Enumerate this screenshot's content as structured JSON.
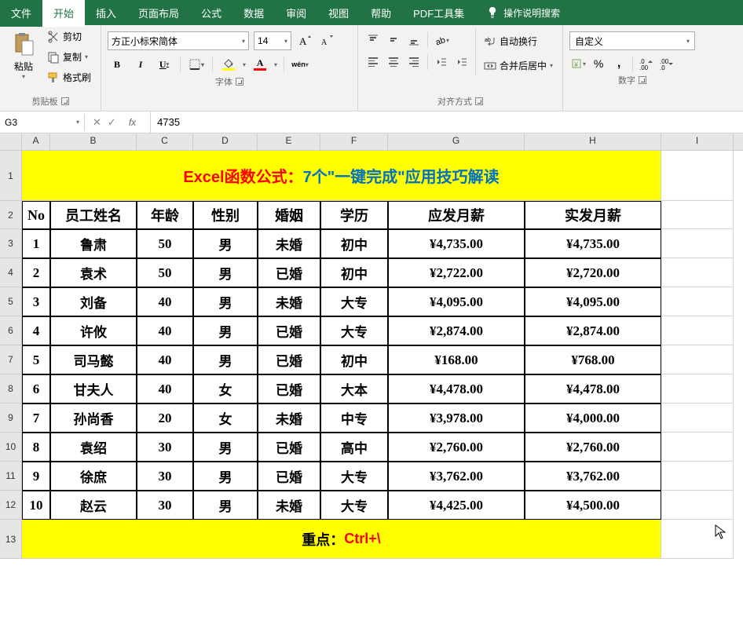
{
  "tabs": {
    "file": "文件",
    "home": "开始",
    "insert": "插入",
    "layout": "页面布局",
    "formulas": "公式",
    "data": "数据",
    "review": "审阅",
    "view": "视图",
    "help": "帮助",
    "pdf": "PDF工具集",
    "search": "操作说明搜索"
  },
  "ribbon": {
    "clipboard": {
      "label": "剪贴板",
      "paste": "粘贴",
      "cut": "剪切",
      "copy": "复制",
      "format_painter": "格式刷"
    },
    "font": {
      "label": "字体",
      "name": "方正小标宋简体",
      "size": "14",
      "bold": "B",
      "italic": "I",
      "underline": "U",
      "wen": "wén"
    },
    "alignment": {
      "label": "对齐方式",
      "wrap": "自动换行",
      "merge": "合并后居中"
    },
    "number": {
      "label": "数字",
      "format": "自定义"
    }
  },
  "formula_bar": {
    "name_box": "G3",
    "value": "4735"
  },
  "columns": [
    "A",
    "B",
    "C",
    "D",
    "E",
    "F",
    "G",
    "H",
    "I"
  ],
  "row_labels": [
    "1",
    "2",
    "3",
    "4",
    "5",
    "6",
    "7",
    "8",
    "9",
    "10",
    "11",
    "12",
    "13"
  ],
  "title": {
    "prefix": "Excel函数公式：",
    "main": "7个\"一键完成\"应用技巧解读"
  },
  "headers": [
    "No",
    "员工姓名",
    "年龄",
    "性别",
    "婚姻",
    "学历",
    "应发月薪",
    "实发月薪"
  ],
  "rows": [
    {
      "no": "1",
      "name": "鲁肃",
      "age": "50",
      "gender": "男",
      "marriage": "未婚",
      "edu": "初中",
      "due": "¥4,735.00",
      "actual": "¥4,735.00"
    },
    {
      "no": "2",
      "name": "袁术",
      "age": "50",
      "gender": "男",
      "marriage": "已婚",
      "edu": "初中",
      "due": "¥2,722.00",
      "actual": "¥2,720.00"
    },
    {
      "no": "3",
      "name": "刘备",
      "age": "40",
      "gender": "男",
      "marriage": "未婚",
      "edu": "大专",
      "due": "¥4,095.00",
      "actual": "¥4,095.00"
    },
    {
      "no": "4",
      "name": "许攸",
      "age": "40",
      "gender": "男",
      "marriage": "已婚",
      "edu": "大专",
      "due": "¥2,874.00",
      "actual": "¥2,874.00"
    },
    {
      "no": "5",
      "name": "司马懿",
      "age": "40",
      "gender": "男",
      "marriage": "已婚",
      "edu": "初中",
      "due": "¥168.00",
      "actual": "¥768.00"
    },
    {
      "no": "6",
      "name": "甘夫人",
      "age": "40",
      "gender": "女",
      "marriage": "已婚",
      "edu": "大本",
      "due": "¥4,478.00",
      "actual": "¥4,478.00"
    },
    {
      "no": "7",
      "name": "孙尚香",
      "age": "20",
      "gender": "女",
      "marriage": "未婚",
      "edu": "中专",
      "due": "¥3,978.00",
      "actual": "¥4,000.00"
    },
    {
      "no": "8",
      "name": "袁绍",
      "age": "30",
      "gender": "男",
      "marriage": "已婚",
      "edu": "高中",
      "due": "¥2,760.00",
      "actual": "¥2,760.00"
    },
    {
      "no": "9",
      "name": "徐庶",
      "age": "30",
      "gender": "男",
      "marriage": "已婚",
      "edu": "大专",
      "due": "¥3,762.00",
      "actual": "¥3,762.00"
    },
    {
      "no": "10",
      "name": "赵云",
      "age": "30",
      "gender": "男",
      "marriage": "未婚",
      "edu": "大专",
      "due": "¥4,425.00",
      "actual": "¥4,500.00"
    }
  ],
  "footer": {
    "prefix": "重点：",
    "main": "Ctrl+\\"
  }
}
